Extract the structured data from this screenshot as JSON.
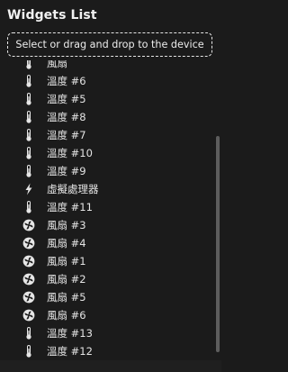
{
  "panel": {
    "title": "Widgets List",
    "drop_hint": "Select or drag and drop to the device"
  },
  "items": [
    {
      "label": "風扇",
      "icon": "thermometer-icon"
    },
    {
      "label": "溫度 #6",
      "icon": "thermometer-icon"
    },
    {
      "label": "溫度 #5",
      "icon": "thermometer-icon"
    },
    {
      "label": "溫度 #8",
      "icon": "thermometer-icon"
    },
    {
      "label": "溫度 #7",
      "icon": "thermometer-icon"
    },
    {
      "label": "溫度 #10",
      "icon": "thermometer-icon"
    },
    {
      "label": "溫度 #9",
      "icon": "thermometer-icon"
    },
    {
      "label": "虛擬處理器",
      "icon": "lightning-icon"
    },
    {
      "label": "溫度 #11",
      "icon": "thermometer-icon"
    },
    {
      "label": "風扇 #3",
      "icon": "fan-icon"
    },
    {
      "label": "風扇 #4",
      "icon": "fan-icon"
    },
    {
      "label": "風扇 #1",
      "icon": "fan-icon"
    },
    {
      "label": "風扇 #2",
      "icon": "fan-icon"
    },
    {
      "label": "風扇 #5",
      "icon": "fan-icon"
    },
    {
      "label": "風扇 #6",
      "icon": "fan-icon"
    },
    {
      "label": "溫度 #13",
      "icon": "thermometer-icon"
    },
    {
      "label": "溫度 #12",
      "icon": "thermometer-icon"
    }
  ]
}
